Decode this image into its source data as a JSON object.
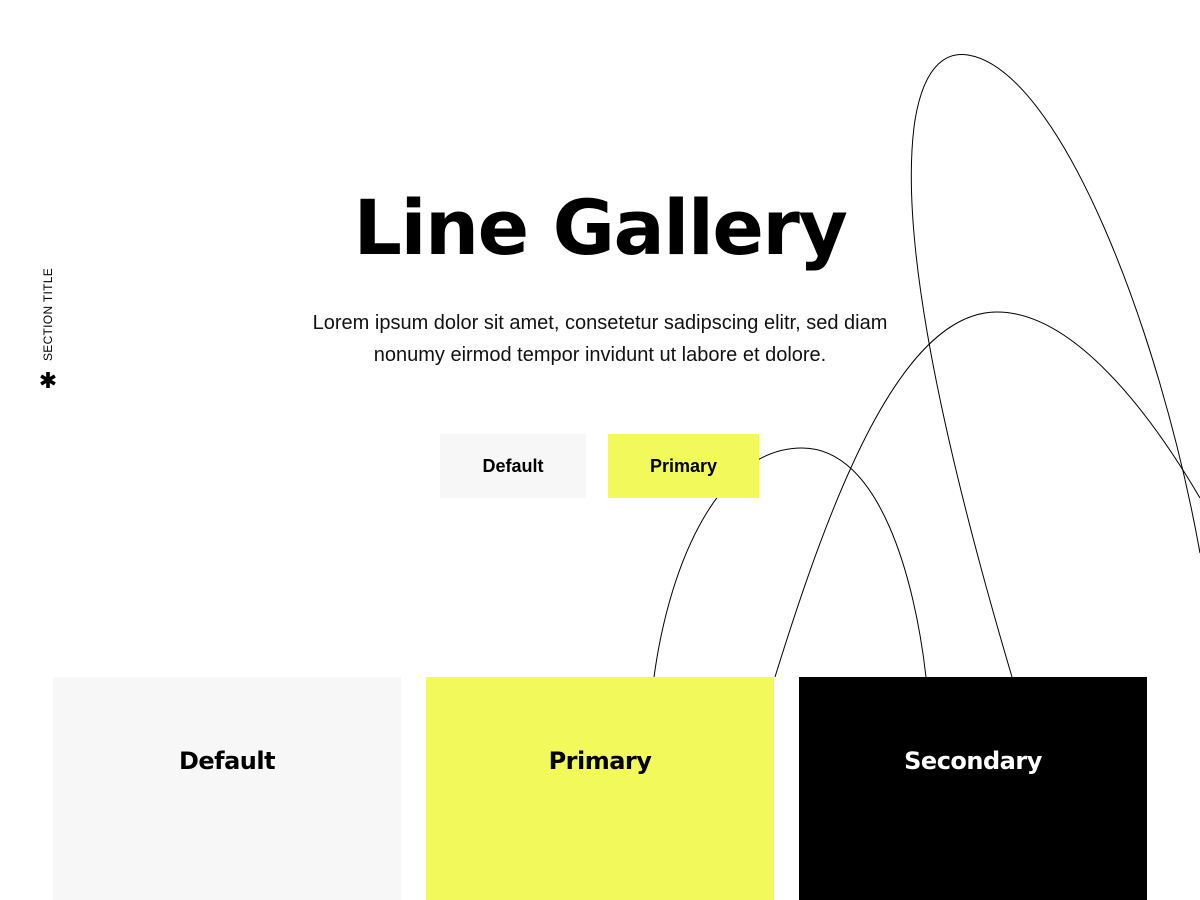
{
  "section": {
    "label": "SECTION TITLE",
    "icon": "asterisk-icon"
  },
  "hero": {
    "title": "Line Gallery",
    "description": "Lorem ipsum dolor sit amet, consetetur sadipscing elitr, sed diam nonumy eirmod tempor invidunt ut labore et dolore."
  },
  "buttons": {
    "default_label": "Default",
    "primary_label": "Primary"
  },
  "cards": [
    {
      "label": "Default"
    },
    {
      "label": "Primary"
    },
    {
      "label": "Secondary"
    }
  ],
  "colors": {
    "primary": "#f2f95a",
    "default_bg": "#f7f7f7",
    "secondary": "#000000",
    "text": "#000000"
  }
}
